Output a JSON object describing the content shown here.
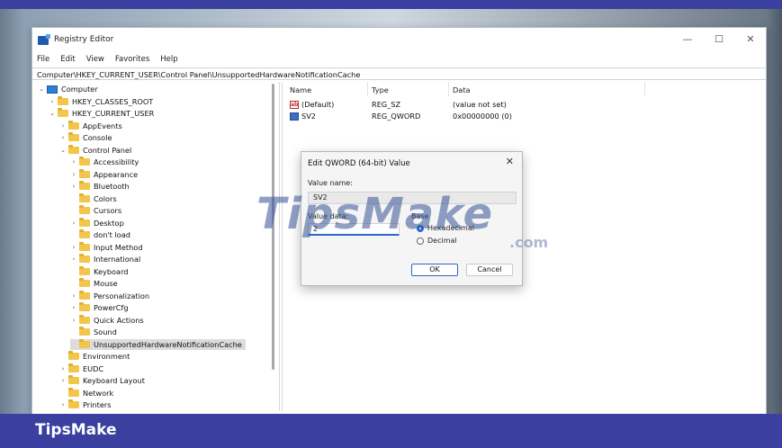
{
  "window": {
    "title": "Registry Editor",
    "controls": {
      "minimize": "—",
      "maximize": "☐",
      "close": "✕"
    }
  },
  "menu": [
    "File",
    "Edit",
    "View",
    "Favorites",
    "Help"
  ],
  "address": "Computer\\HKEY_CURRENT_USER\\Control Panel\\UnsupportedHardwareNotificationCache",
  "tree": [
    {
      "label": "Computer",
      "level": 0,
      "expander": "expanded",
      "icon": "computer-icon"
    },
    {
      "label": "HKEY_CLASSES_ROOT",
      "level": 1,
      "expander": "collapsed",
      "icon": "folder-icon"
    },
    {
      "label": "HKEY_CURRENT_USER",
      "level": 1,
      "expander": "expanded",
      "icon": "folder-icon"
    },
    {
      "label": "AppEvents",
      "level": 2,
      "expander": "collapsed",
      "icon": "folder-icon"
    },
    {
      "label": "Console",
      "level": 2,
      "expander": "collapsed",
      "icon": "folder-icon"
    },
    {
      "label": "Control Panel",
      "level": 2,
      "expander": "expanded",
      "icon": "folder-icon"
    },
    {
      "label": "Accessibility",
      "level": 3,
      "expander": "collapsed",
      "icon": "folder-icon"
    },
    {
      "label": "Appearance",
      "level": 3,
      "expander": "collapsed",
      "icon": "folder-icon"
    },
    {
      "label": "Bluetooth",
      "level": 3,
      "expander": "collapsed",
      "icon": "folder-icon"
    },
    {
      "label": "Colors",
      "level": 3,
      "expander": "none",
      "icon": "folder-icon"
    },
    {
      "label": "Cursors",
      "level": 3,
      "expander": "none",
      "icon": "folder-icon"
    },
    {
      "label": "Desktop",
      "level": 3,
      "expander": "collapsed",
      "icon": "folder-icon"
    },
    {
      "label": "don't load",
      "level": 3,
      "expander": "none",
      "icon": "folder-icon"
    },
    {
      "label": "Input Method",
      "level": 3,
      "expander": "collapsed",
      "icon": "folder-icon"
    },
    {
      "label": "International",
      "level": 3,
      "expander": "collapsed",
      "icon": "folder-icon"
    },
    {
      "label": "Keyboard",
      "level": 3,
      "expander": "none",
      "icon": "folder-icon"
    },
    {
      "label": "Mouse",
      "level": 3,
      "expander": "none",
      "icon": "folder-icon"
    },
    {
      "label": "Personalization",
      "level": 3,
      "expander": "collapsed",
      "icon": "folder-icon"
    },
    {
      "label": "PowerCfg",
      "level": 3,
      "expander": "collapsed",
      "icon": "folder-icon"
    },
    {
      "label": "Quick Actions",
      "level": 3,
      "expander": "collapsed",
      "icon": "folder-icon"
    },
    {
      "label": "Sound",
      "level": 3,
      "expander": "none",
      "icon": "folder-icon"
    },
    {
      "label": "UnsupportedHardwareNotificationCache",
      "level": 3,
      "expander": "none",
      "icon": "folder-icon",
      "selected": true
    },
    {
      "label": "Environment",
      "level": 2,
      "expander": "none",
      "icon": "folder-icon"
    },
    {
      "label": "EUDC",
      "level": 2,
      "expander": "collapsed",
      "icon": "folder-icon"
    },
    {
      "label": "Keyboard Layout",
      "level": 2,
      "expander": "collapsed",
      "icon": "folder-icon"
    },
    {
      "label": "Network",
      "level": 2,
      "expander": "none",
      "icon": "folder-icon"
    },
    {
      "label": "Printers",
      "level": 2,
      "expander": "collapsed",
      "icon": "folder-icon"
    }
  ],
  "values_list": {
    "headers": {
      "name": "Name",
      "type": "Type",
      "data": "Data"
    },
    "rows": [
      {
        "name": "(Default)",
        "type": "REG_SZ",
        "data": "(value not set)",
        "icon": "string-value-icon"
      },
      {
        "name": "SV2",
        "type": "REG_QWORD",
        "data": "0x00000000 (0)",
        "icon": "binary-value-icon"
      }
    ]
  },
  "dialog": {
    "title": "Edit QWORD (64-bit) Value",
    "close": "✕",
    "value_name_label": "Value name:",
    "value_name": "SV2",
    "value_data_label": "Value data:",
    "value_data": "2",
    "base_label": "Base",
    "base_hex": "Hexadecimal",
    "base_dec": "Decimal",
    "base_selected": "Hexadecimal",
    "ok": "OK",
    "cancel": "Cancel"
  },
  "watermark": {
    "main": "TipsMake",
    "suffix": ".com"
  },
  "footer": {
    "brand": "TipsMake"
  },
  "colors": {
    "accent": "#2b67c9",
    "footer": "#3a3fa0",
    "folder": "#f2c64a"
  }
}
